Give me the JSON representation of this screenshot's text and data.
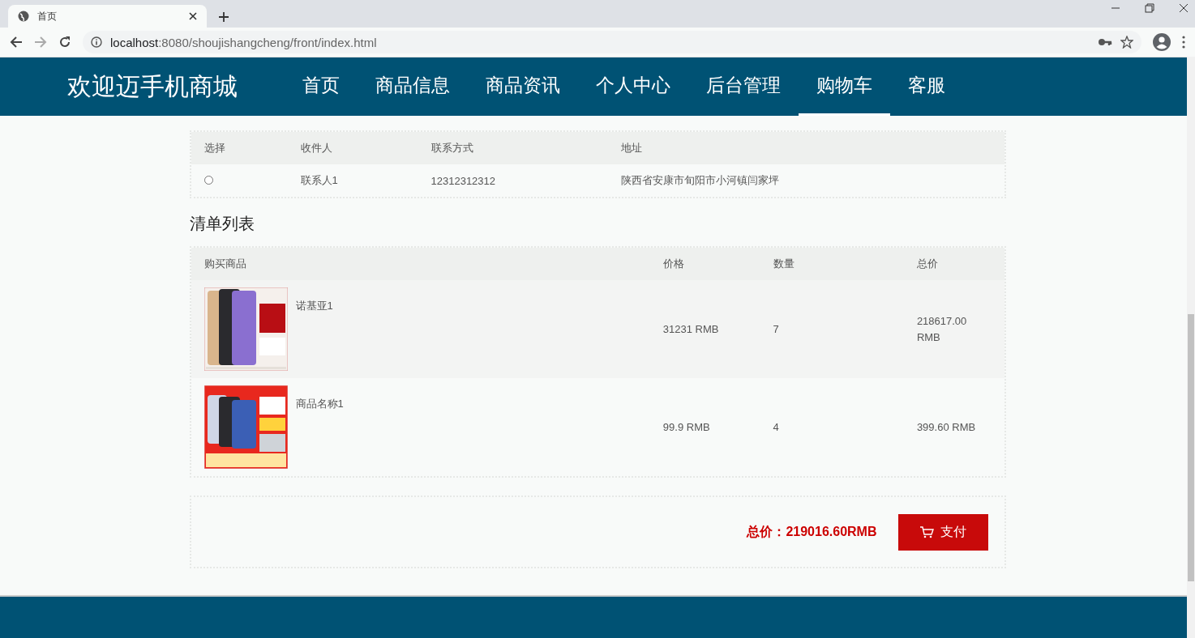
{
  "browser": {
    "tab_title": "首页",
    "url_host": "localhost",
    "url_rest": ":8080/shoujishangcheng/front/index.html"
  },
  "nav": {
    "brand": "欢迎迈手机商城",
    "items": [
      {
        "label": "首页",
        "selected": false
      },
      {
        "label": "商品信息",
        "selected": false
      },
      {
        "label": "商品资讯",
        "selected": false
      },
      {
        "label": "个人中心",
        "selected": false
      },
      {
        "label": "后台管理",
        "selected": false
      },
      {
        "label": "购物车",
        "selected": true
      },
      {
        "label": "客服",
        "selected": false
      }
    ]
  },
  "address_table": {
    "columns": [
      "选择",
      "收件人",
      "联系方式",
      "地址"
    ],
    "rows": [
      {
        "selected": false,
        "recipient": "联系人1",
        "phone": "12312312312",
        "address": "陕西省安康市旬阳市小河镇闫家坪"
      }
    ]
  },
  "list_title": "清单列表",
  "items_table": {
    "columns": [
      "购买商品",
      "价格",
      "数量",
      "总价"
    ],
    "rows": [
      {
        "name": "诺基亚1",
        "price": "31231 RMB",
        "quantity": "7",
        "total": "218617.00 RMB"
      },
      {
        "name": "商品名称1",
        "price": "99.9 RMB",
        "quantity": "4",
        "total": "399.60 RMB"
      }
    ]
  },
  "summary": {
    "total": "总价：219016.60RMB",
    "pay_button": "支付"
  }
}
